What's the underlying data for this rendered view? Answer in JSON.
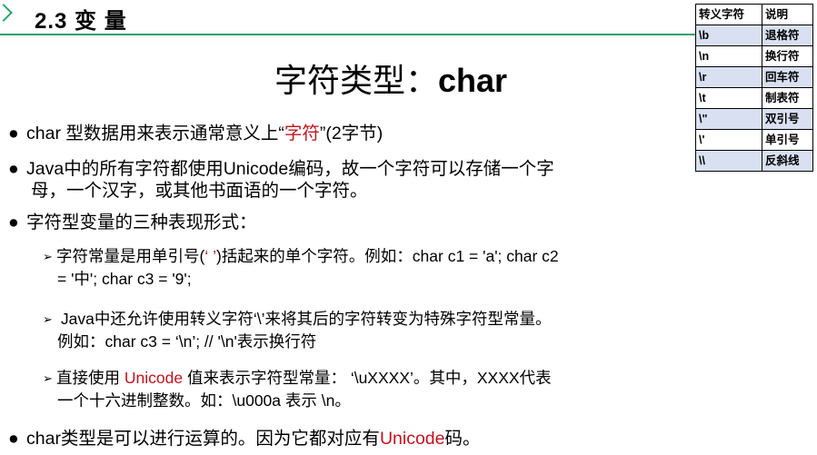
{
  "header": {
    "section_title": "2.3 变 量"
  },
  "slide_title": {
    "cn": "字符类型：",
    "en": "char"
  },
  "escape_table": {
    "headers": [
      "转义字符",
      "说明"
    ],
    "rows": [
      [
        "\\b",
        "退格符"
      ],
      [
        "\\n",
        "换行符"
      ],
      [
        "\\r",
        "回车符"
      ],
      [
        "\\t",
        "制表符"
      ],
      [
        "\\\"",
        "双引号"
      ],
      [
        "\\'",
        "单引号"
      ],
      [
        "\\\\",
        "反斜线"
      ]
    ]
  },
  "bullets": {
    "b1": {
      "pre": "char 型数据用来表示通常意义上“",
      "highlight": "字符",
      "post": "”(2字节)"
    },
    "b2": {
      "line1": "Java中的所有字符都使用Unicode编码，故一个字符可以存储一个字",
      "line2": "母，一个汉字，或其他书面语的一个字符。"
    },
    "b3": {
      "text": "字符型变量的三种表现形式："
    },
    "s1": {
      "pre": "字符常量是用单引号(",
      "quote": "‘ ’",
      "post": ")括起来的单个字符。例如：char c1 = 'a';   char c2",
      "line2": "= '中'; char c3 =  '9';"
    },
    "s2": {
      "line1": " Java中还允许使用转义字符‘\\’来将其后的字符转变为特殊字符型常量。",
      "line2": "例如：char c3 = ‘\\n’;  // '\\n'表示换行符"
    },
    "s3": {
      "pre": "直接使用 ",
      "highlight": "Unicode",
      "post": " 值来表示字符型常量：  ‘\\uXXXX’。其中，XXXX代表",
      "line2": "一个十六进制整数。如：\\u000a 表示 \\n。"
    },
    "b4": {
      "pre": "char类型是可以进行运算的。因为它都对应有",
      "highlight": "Unicode",
      "post": "码。"
    }
  },
  "colors": {
    "accent_green": "#2aa36b",
    "highlight_red": "#c0141e",
    "table_stripe": "#d8e0f1"
  }
}
